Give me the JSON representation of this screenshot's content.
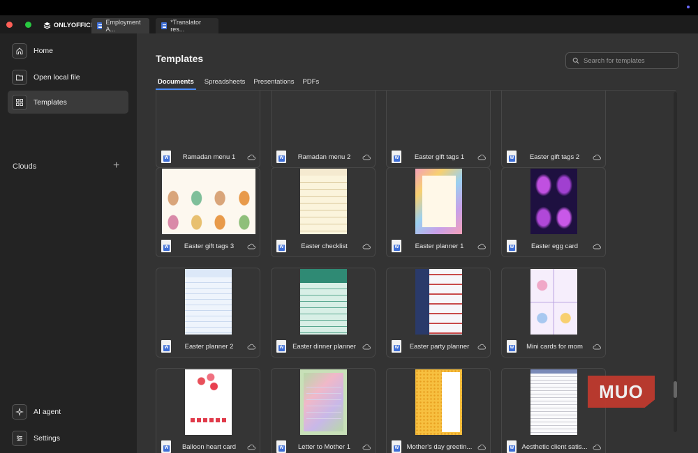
{
  "window": {
    "brand": "ONLYOFFICE",
    "tabs": [
      {
        "label": "Employment A..."
      },
      {
        "label": "*Translator res..."
      }
    ]
  },
  "sidebar": {
    "items": [
      {
        "label": "Home",
        "icon": "home-icon"
      },
      {
        "label": "Open local file",
        "icon": "folder-icon"
      },
      {
        "label": "Templates",
        "icon": "grid-icon",
        "active": true
      }
    ],
    "clouds_label": "Clouds",
    "clouds_add": "+",
    "bottom": [
      {
        "label": "AI agent",
        "icon": "ai-agent-icon"
      },
      {
        "label": "Settings",
        "icon": "sliders-icon"
      }
    ]
  },
  "main": {
    "title": "Templates",
    "search_placeholder": "Search for templates",
    "tabs": [
      "Documents",
      "Spreadsheets",
      "Presentations",
      "PDFs"
    ],
    "active_tab": "Documents",
    "templates": [
      {
        "name": "Ramadan menu 1"
      },
      {
        "name": "Ramadan menu 2"
      },
      {
        "name": "Easter gift tags 1"
      },
      {
        "name": "Easter gift tags 2"
      },
      {
        "name": "Easter gift tags 3"
      },
      {
        "name": "Easter checklist"
      },
      {
        "name": "Easter planner 1"
      },
      {
        "name": "Easter egg card"
      },
      {
        "name": "Easter planner 2"
      },
      {
        "name": "Easter dinner planner"
      },
      {
        "name": "Easter party planner"
      },
      {
        "name": "Mini cards for mom"
      },
      {
        "name": "Balloon heart card"
      },
      {
        "name": "Letter to Mother 1"
      },
      {
        "name": "Mother's day greetin..."
      },
      {
        "name": "Aesthetic client satis..."
      }
    ]
  },
  "watermark": "MUO",
  "colors": {
    "accent": "#4a8cff",
    "watermark": "#c33a2e"
  }
}
